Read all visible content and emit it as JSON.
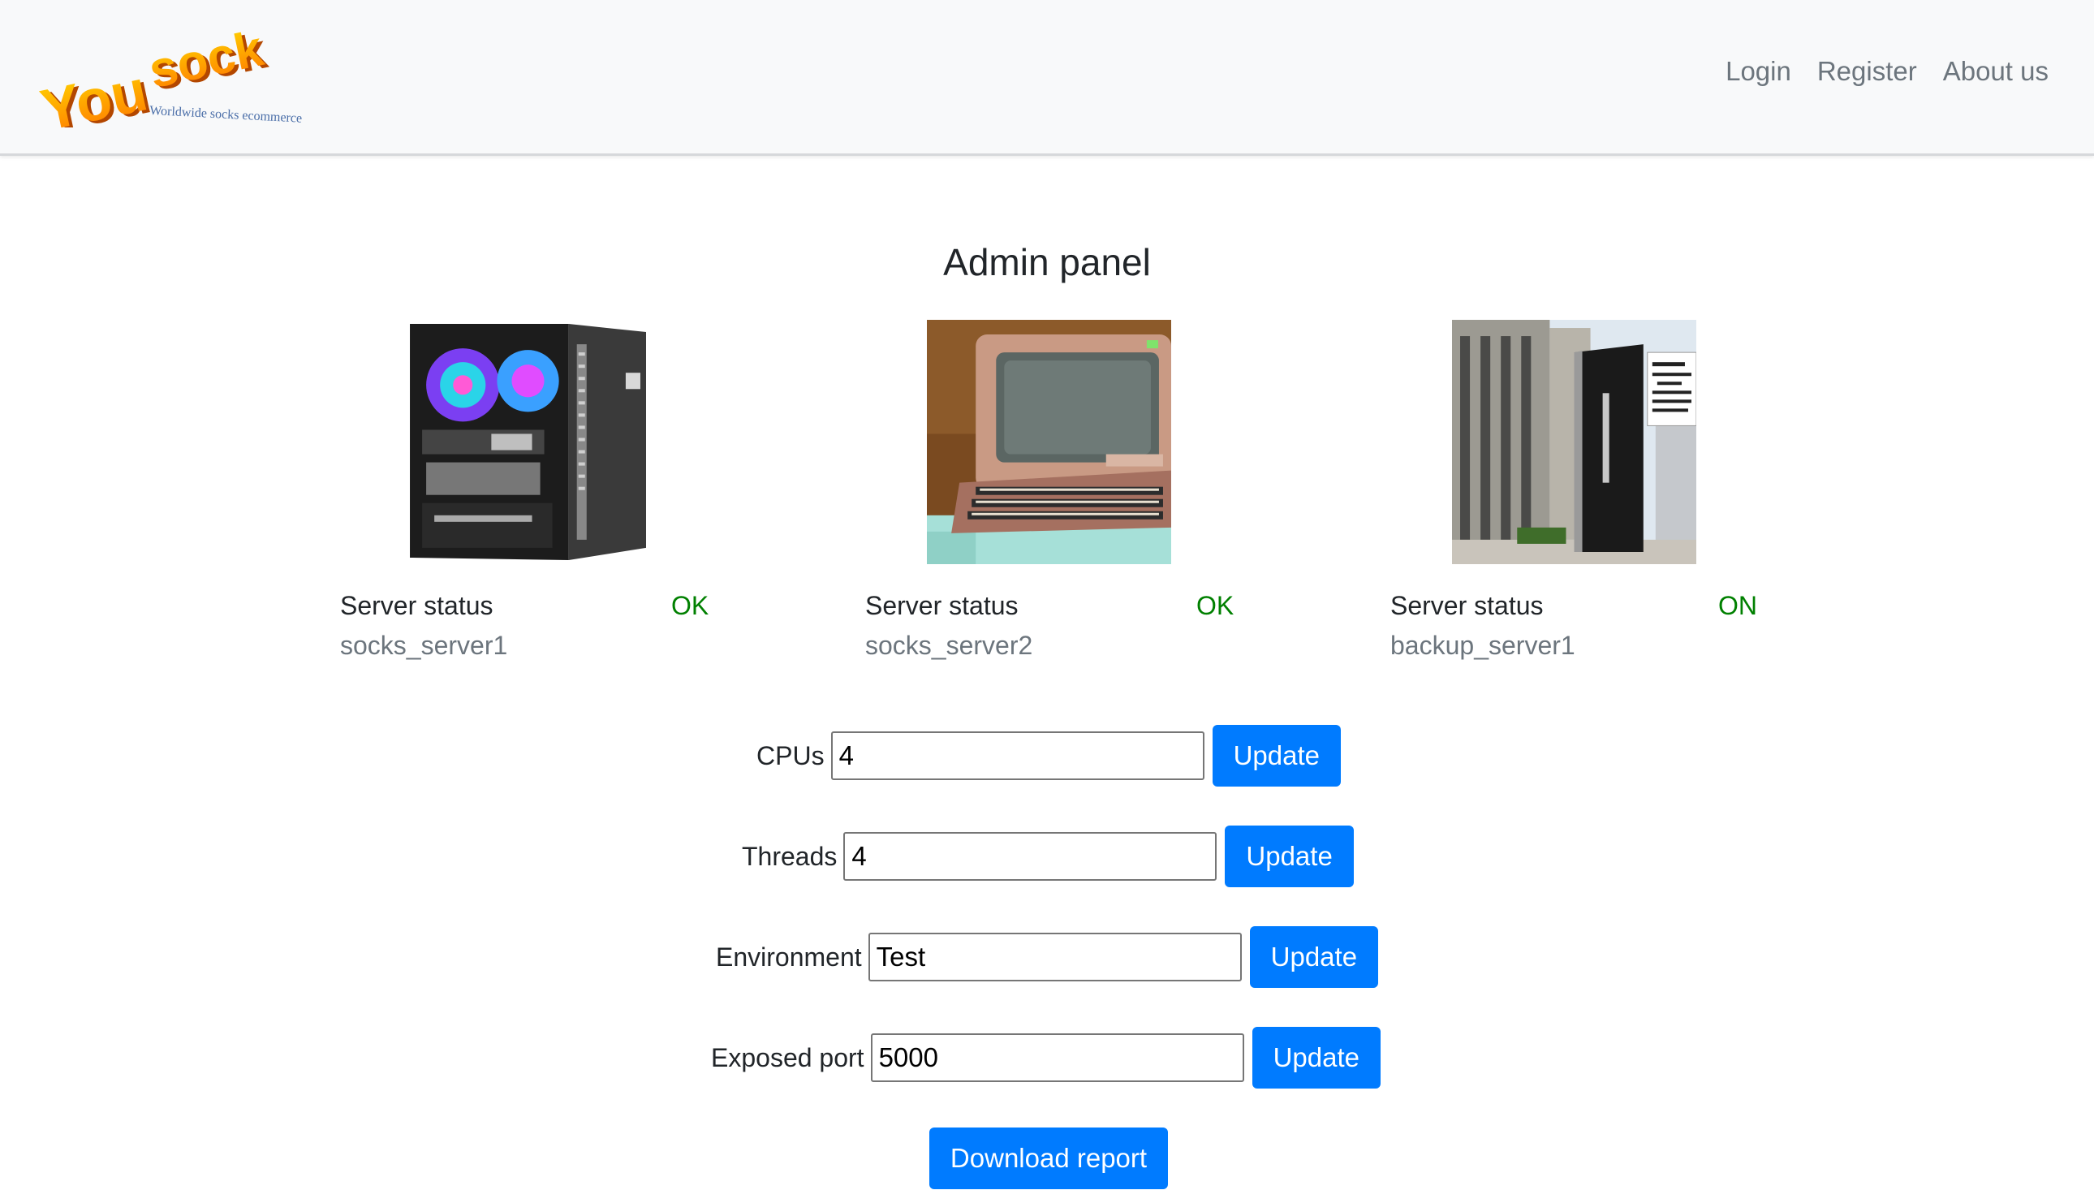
{
  "brand": {
    "logo_text": "You sock",
    "tagline": "Worldwide socks ecommerce"
  },
  "nav": {
    "links": [
      "Login",
      "Register",
      "About us"
    ]
  },
  "page": {
    "title": "Admin panel"
  },
  "servers": [
    {
      "status_label": "Server status",
      "status": "OK",
      "name": "socks_server1",
      "status_color": "#008000",
      "image": "tower-pc-image"
    },
    {
      "status_label": "Server status",
      "status": "OK",
      "name": "socks_server2",
      "status_color": "#008000",
      "image": "retro-computer-image"
    },
    {
      "status_label": "Server status",
      "status": "ON",
      "name": "backup_server1",
      "status_color": "#008000",
      "image": "server-monolith-image"
    }
  ],
  "settings": {
    "cpus": {
      "label": "CPUs",
      "value": "4",
      "button": "Update"
    },
    "threads": {
      "label": "Threads",
      "value": "4",
      "button": "Update"
    },
    "environment": {
      "label": "Environment",
      "value": "Test",
      "button": "Update"
    },
    "port": {
      "label": "Exposed port",
      "value": "5000",
      "button": "Update"
    }
  },
  "actions": {
    "download_label": "Download report"
  },
  "colors": {
    "primary": "#007bff",
    "status_ok": "#008000",
    "navbar_bg": "#f8f9fa",
    "muted_text": "#6c757d"
  }
}
